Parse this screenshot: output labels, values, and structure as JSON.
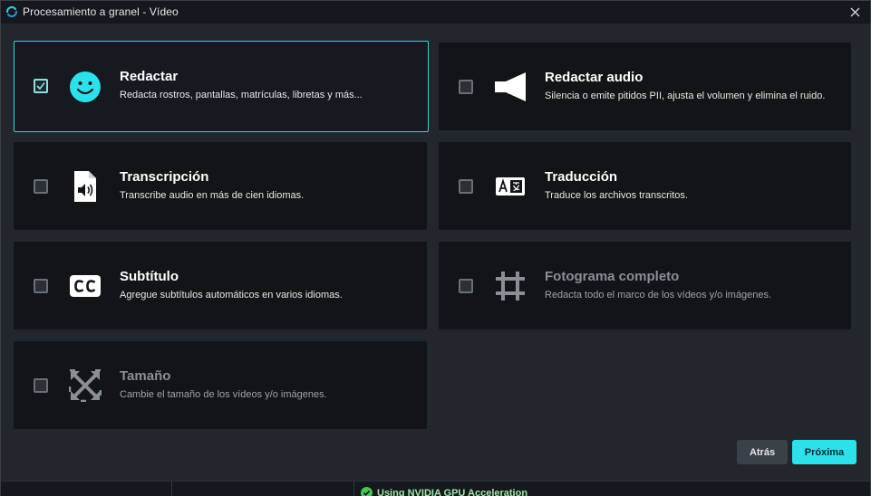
{
  "window": {
    "title": "Procesamiento a granel - Vídeo",
    "accent_color": "#3fd0da"
  },
  "options": [
    {
      "id": "redact",
      "title": "Redactar",
      "description": "Redacta rostros, pantallas, matrículas, libretas y más...",
      "checked": true,
      "enabled": true,
      "icon": "smiley-face-icon"
    },
    {
      "id": "redact-audio",
      "title": "Redactar audio",
      "description": "Silencia o emite pitidos PII, ajusta el volumen y elimina el ruido.",
      "checked": false,
      "enabled": true,
      "icon": "speaker-icon"
    },
    {
      "id": "transcription",
      "title": "Transcripción",
      "description": "Transcribe audio en más de cien idiomas.",
      "checked": false,
      "enabled": true,
      "icon": "audio-file-icon"
    },
    {
      "id": "translation",
      "title": "Traducción",
      "description": "Traduce los archivos transcritos.",
      "checked": false,
      "enabled": true,
      "icon": "translate-icon"
    },
    {
      "id": "subtitle",
      "title": "Subtítulo",
      "description": "Agregue subtítulos automáticos en varios idiomas.",
      "checked": false,
      "enabled": true,
      "icon": "closed-caption-icon"
    },
    {
      "id": "full-frame",
      "title": "Fotograma completo",
      "description": "Redacta todo el marco de los vídeos y/o imágenes.",
      "checked": false,
      "enabled": false,
      "icon": "crop-frame-icon"
    },
    {
      "id": "resize",
      "title": "Tamaño",
      "description": "Cambie el tamaño de los vídeos y/o imágenes.",
      "checked": false,
      "enabled": false,
      "icon": "resize-arrows-icon"
    }
  ],
  "buttons": {
    "back_label": "Atrás",
    "next_label": "Próxima"
  },
  "status": {
    "gpu_text": "Using NVIDIA GPU Acceleration",
    "gpu_color": "#4cc35a"
  }
}
